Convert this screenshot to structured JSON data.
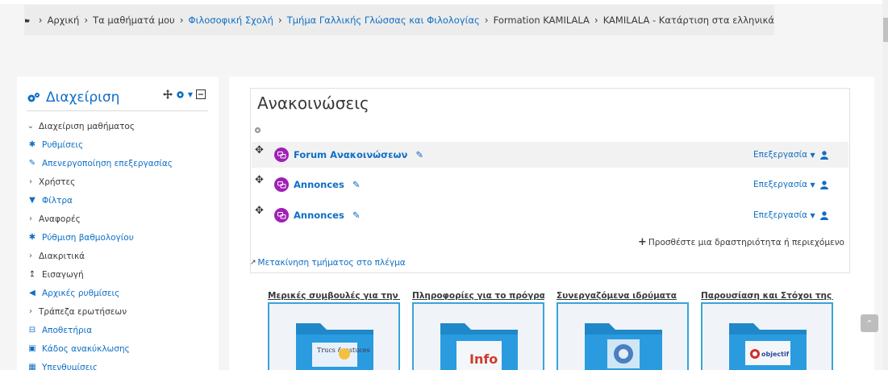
{
  "breadcrumb": [
    {
      "label": "Αρχική",
      "link": false
    },
    {
      "label": "Τα μαθήματά μου",
      "link": false
    },
    {
      "label": "Φιλοσοφική Σχολή",
      "link": true
    },
    {
      "label": "Τμήμα Γαλλικής Γλώσσας και Φιλολογίας",
      "link": true
    },
    {
      "label": "Formation KAMILALA",
      "link": false
    },
    {
      "label": "KAMILALA - Κατάρτιση στα ελληνικά",
      "link": false
    }
  ],
  "admin": {
    "title": "Διαχείριση",
    "items": [
      {
        "label": "Διαχείριση μαθήματος",
        "icon": "chevron-down-icon",
        "link": false
      },
      {
        "label": "Ρυθμίσεις",
        "icon": "gear-icon",
        "link": true
      },
      {
        "label": "Απενεργοποίηση επεξεργασίας",
        "icon": "pencil-icon",
        "link": true
      },
      {
        "label": "Χρήστες",
        "icon": "chevron-right-icon",
        "link": false
      },
      {
        "label": "Φίλτρα",
        "icon": "filter-icon",
        "link": true
      },
      {
        "label": "Αναφορές",
        "icon": "chevron-right-icon",
        "link": false
      },
      {
        "label": "Ρύθμιση βαθμολογίου",
        "icon": "gear-icon",
        "link": true
      },
      {
        "label": "Διακριτικά",
        "icon": "chevron-right-icon",
        "link": false
      },
      {
        "label": "Εισαγωγή",
        "icon": "upload-icon",
        "link": false
      },
      {
        "label": "Αρχικές ρυθμίσεις",
        "icon": "arrow-left-icon",
        "link": true
      },
      {
        "label": "Τράπεζα ερωτήσεων",
        "icon": "chevron-right-icon",
        "link": false
      },
      {
        "label": "Αποθετήρια",
        "icon": "archive-icon",
        "link": true
      },
      {
        "label": "Κάδος ανακύκλωσης",
        "icon": "trash-icon",
        "link": true
      },
      {
        "label": "Υπενθυμίσεις",
        "icon": "calendar-icon",
        "link": true
      }
    ]
  },
  "section": {
    "title": "Ανακοινώσεις",
    "activities": [
      {
        "name": "Forum Ανακοινώσεων",
        "edit_label": "Επεξεργασία"
      },
      {
        "name": "Annonces",
        "edit_label": "Επεξεργασία"
      },
      {
        "name": "Annonces",
        "edit_label": "Επεξεργασία"
      }
    ],
    "add_activity_label": "Προσθέστε μια δραστηριότητα ή περιεχόμενο",
    "move_section_label": "Μετακίνηση τμήματος στο πλέγμα"
  },
  "tiles": [
    {
      "title": "Μερικές συμβουλές για την ...",
      "image_text": "Trucs & astuces"
    },
    {
      "title": "Πληροφορίες για το πρόγρα...",
      "image_text": "Info"
    },
    {
      "title": "Συνεργαζόμενα ιδρύματα",
      "image_text": ""
    },
    {
      "title": "Παρουσίαση και Στόχοι της ...",
      "image_text": "objectif"
    }
  ],
  "colors": {
    "link": "#0f6fc5",
    "forum_icon": "#a020b5",
    "tile_border": "#3aa3d8"
  }
}
